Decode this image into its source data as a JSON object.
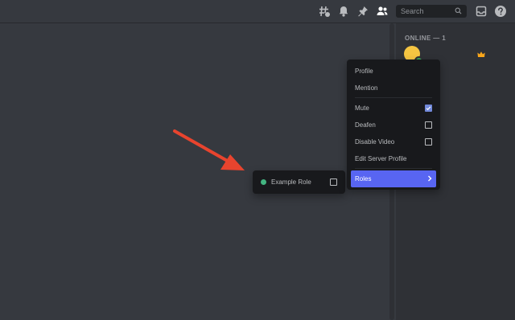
{
  "topbar": {
    "icons": [
      "threads-icon",
      "notification-bell-icon",
      "pin-icon",
      "members-icon",
      "inbox-icon",
      "help-icon"
    ],
    "search": {
      "placeholder": "Search",
      "value": ""
    }
  },
  "members": {
    "heading": "ONLINE — 1",
    "list": [
      {
        "avatar_color": "#f5c542",
        "status": "online",
        "owner_crown": true
      }
    ]
  },
  "context_menu": {
    "items": [
      {
        "label": "Profile"
      },
      {
        "label": "Mention"
      },
      {
        "label": "Mute",
        "checked": true
      },
      {
        "label": "Deafen",
        "checked": false
      },
      {
        "label": "Disable Video",
        "checked": false
      },
      {
        "label": "Edit Server Profile"
      },
      {
        "label": "Roles",
        "active": true,
        "submenu": true
      }
    ]
  },
  "roles_submenu": {
    "roles": [
      {
        "label": "Example Role",
        "color": "#43b581",
        "checked": false
      }
    ]
  },
  "annotation": {
    "arrow_color": "#e8442e"
  }
}
